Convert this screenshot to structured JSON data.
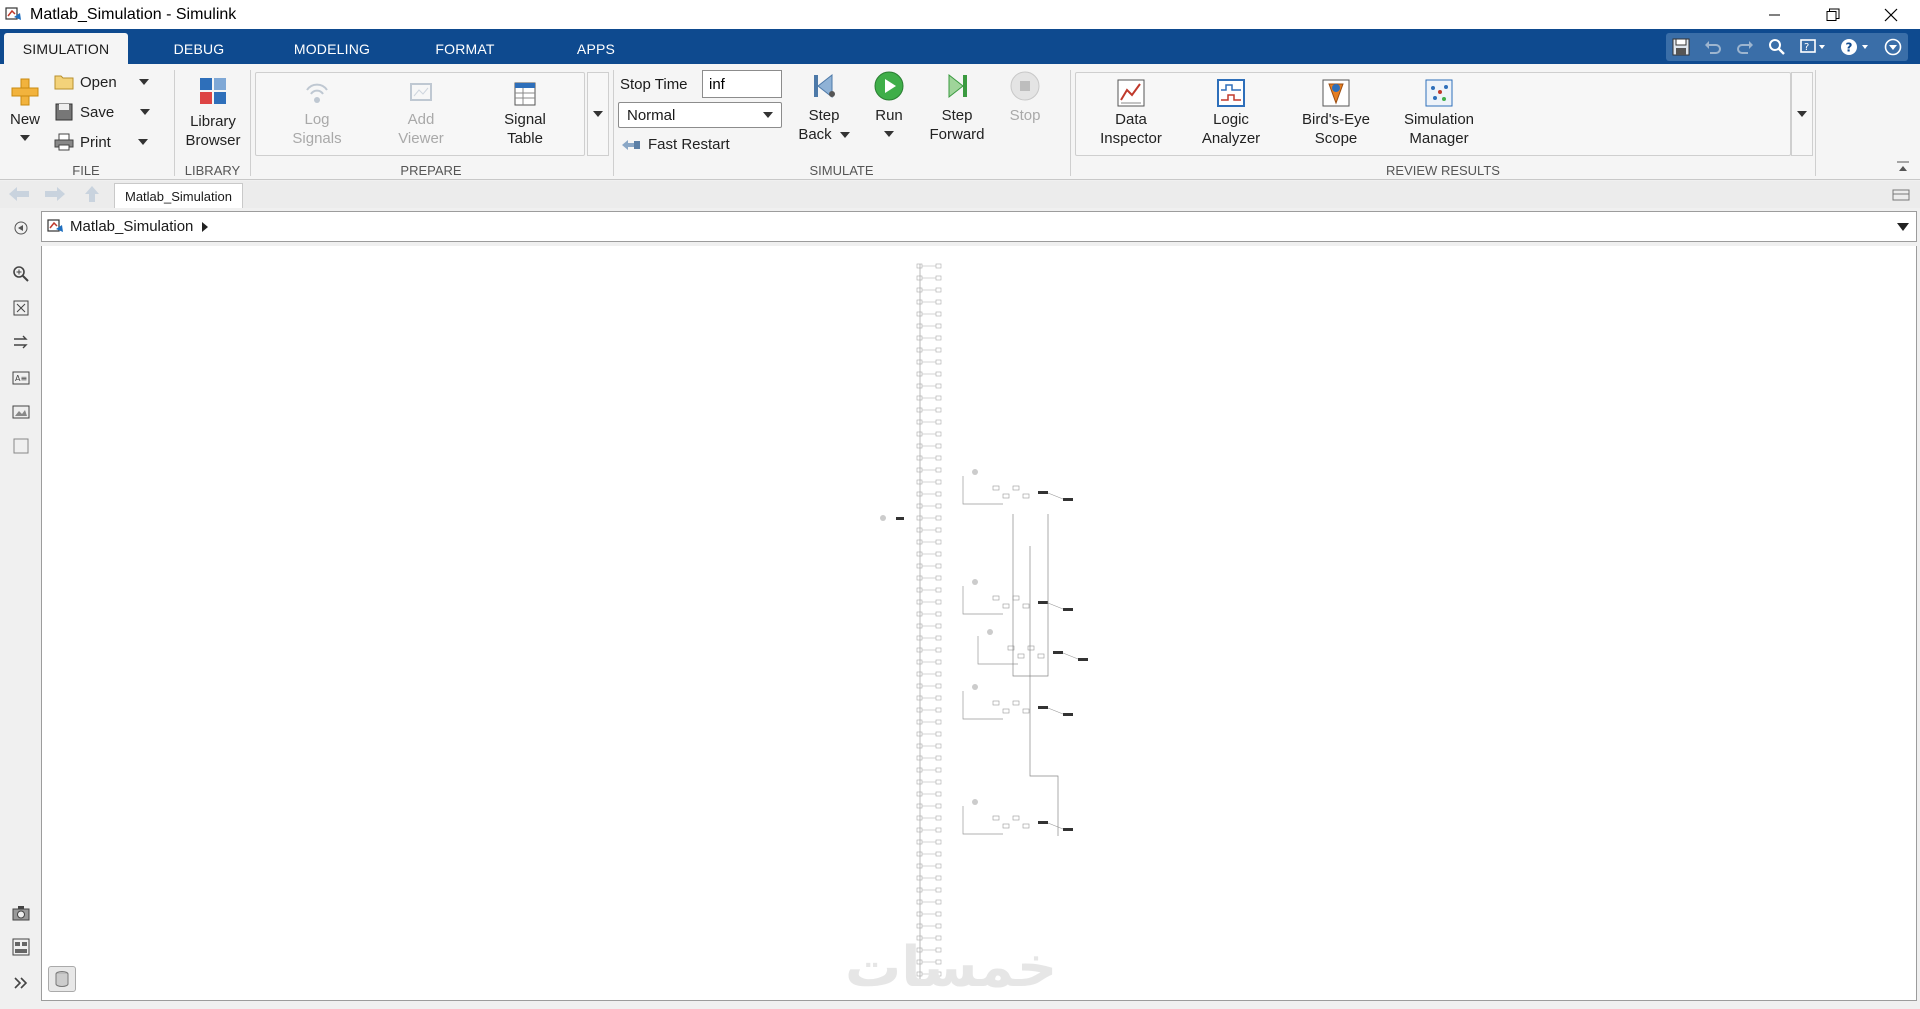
{
  "window": {
    "title": "Matlab_Simulation - Simulink"
  },
  "tabs": [
    {
      "label": "SIMULATION"
    },
    {
      "label": "DEBUG"
    },
    {
      "label": "MODELING"
    },
    {
      "label": "FORMAT"
    },
    {
      "label": "APPS"
    }
  ],
  "ribbon": {
    "file": {
      "label": "FILE",
      "new": "New",
      "open": "Open",
      "save": "Save",
      "print": "Print"
    },
    "library": {
      "label": "LIBRARY",
      "browser_line1": "Library",
      "browser_line2": "Browser"
    },
    "prepare": {
      "label": "PREPARE",
      "log_line1": "Log",
      "log_line2": "Signals",
      "viewer_line1": "Add",
      "viewer_line2": "Viewer",
      "table_line1": "Signal",
      "table_line2": "Table"
    },
    "simulate": {
      "label": "SIMULATE",
      "stop_time_label": "Stop Time",
      "stop_time_value": "inf",
      "mode": "Normal",
      "fast_restart": "Fast Restart",
      "step_back_line1": "Step",
      "step_back_line2": "Back",
      "run": "Run",
      "step_forward_line1": "Step",
      "step_forward_line2": "Forward",
      "stop": "Stop"
    },
    "review": {
      "label": "REVIEW RESULTS",
      "data_inspector_line1": "Data",
      "data_inspector_line2": "Inspector",
      "logic_analyzer_line1": "Logic",
      "logic_analyzer_line2": "Analyzer",
      "birds_eye_line1": "Bird's-Eye",
      "birds_eye_line2": "Scope",
      "sim_manager_line1": "Simulation",
      "sim_manager_line2": "Manager"
    }
  },
  "document_tab": "Matlab_Simulation",
  "breadcrumb": "Matlab_Simulation",
  "watermark": "خمسات"
}
